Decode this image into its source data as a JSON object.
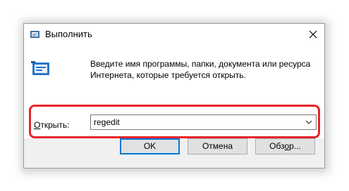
{
  "window": {
    "title": "Выполнить",
    "close_glyph": "✕"
  },
  "dialog": {
    "description_line1": "Введите имя программы, папки, документа или ресурса",
    "description_line2": "Интернета, которые требуется открыть.",
    "open_label_accel": "О",
    "open_label_rest": "ткрыть:",
    "input_value": "regedit",
    "highlight_color": "#e8232a"
  },
  "buttons": {
    "ok": "OK",
    "cancel": "Отмена",
    "browse_before": "Обз",
    "browse_accel": "о",
    "browse_after": "р..."
  },
  "icons": {
    "title": "run-icon",
    "main": "run-icon",
    "close": "close-icon",
    "dropdown": "chevron-down-icon"
  }
}
